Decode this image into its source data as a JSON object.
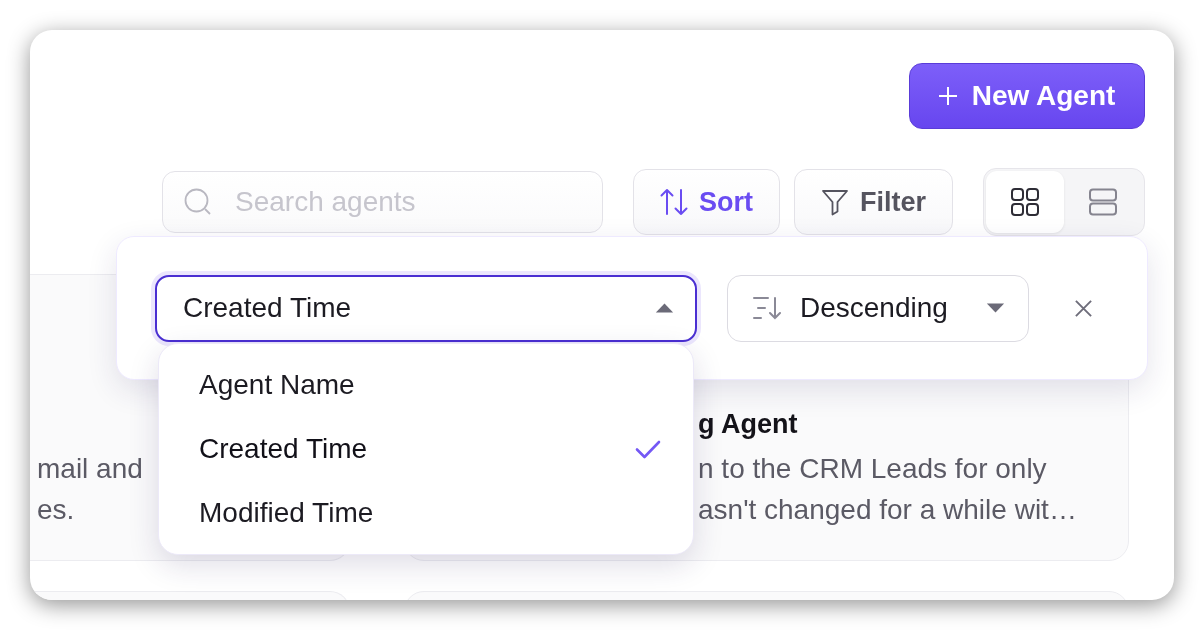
{
  "new_agent_button": {
    "label": "New Agent"
  },
  "toolbar": {
    "search": {
      "placeholder": "Search agents"
    },
    "buttons": [
      {
        "kind": "sort",
        "label": "Sort",
        "active": true
      },
      {
        "kind": "filter",
        "label": "Filter",
        "active": false
      }
    ],
    "views": [
      {
        "kind": "grid",
        "selected": true
      },
      {
        "kind": "list",
        "selected": false
      }
    ]
  },
  "cards": [
    {
      "description_lines": [
        "mail and",
        "es."
      ]
    },
    {
      "title": "g Agent",
      "description_lines": [
        "n to the CRM Leads for only",
        "asn't changed for a while wit…"
      ]
    }
  ],
  "sort_panel": {
    "field": {
      "value": "Created Time",
      "expanded": true
    },
    "options": [
      {
        "label": "Agent Name",
        "selected": false
      },
      {
        "label": "Created Time",
        "selected": true
      },
      {
        "label": "Modified Time",
        "selected": false
      }
    ],
    "order": {
      "value": "Descending",
      "expanded": false
    }
  }
}
